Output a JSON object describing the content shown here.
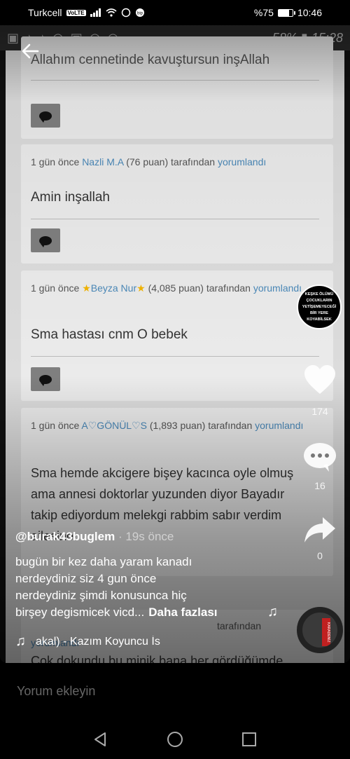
{
  "status_bar": {
    "carrier": "Turkcell",
    "volte": "VoLTE",
    "battery_text": "%75",
    "battery_level": 0.75,
    "time": "10:46"
  },
  "inner_status": {
    "battery_text": "58%",
    "time": "15:28"
  },
  "comments": [
    {
      "text_partial": "Allahım cennetinde kavuştursun inşAllah"
    },
    {
      "ago": "1 gün önce",
      "user": "Nazli M.A",
      "points": "(76 puan)",
      "by": "tarafından",
      "action": "yorumlandı",
      "text": "Amin inşallah"
    },
    {
      "ago": "1 gün önce",
      "user": "Beyza Nur",
      "points": "(4,085 puan)",
      "by": "tarafından",
      "action": "yorumlandı",
      "text": "Sma hastası cnm O bebek"
    },
    {
      "ago": "1 gün önce",
      "user": "A♡GÖNÜL♡S",
      "points": "(1,893 puan)",
      "by": "tarafından",
      "action": "yorumlandı",
      "text_lines": [
        "Sma hemde akcigere bişey kacınca oyle olmuş",
        "ama annesi doktorlar yuzunden diyor Bayadır",
        "takip ediyordum melekgi rabbim sabır verdim",
        "ailesine"
      ]
    },
    {
      "by": "tarafından",
      "action": "yorumlandı",
      "text_partial": "Çok dokundu bu minik bana her gördüğümde"
    }
  ],
  "video": {
    "username": "@burak43buglem",
    "ago": "· 19s önce",
    "caption_lines": [
      "bugün bir kez daha yaram kanadı",
      "nerdeydiniz siz 4 gun önce",
      "nerdeydiniz şimdi konusunca hiç",
      "birşey degismicek vicd..."
    ],
    "more_label": "Daha fazlası",
    "music": "akal) - Kazım Koyuncu    İs",
    "likes": "174",
    "comments_count": "16",
    "shares": "0",
    "avatar_text": "KEŞKE ÖLÜMÜ ÇOCUKLARIN YETİŞEMEYECEĞİ BİR YERE KOYABİLSEK",
    "disc_text": "KARADENİZ"
  },
  "comment_bar": {
    "placeholder": "Yorum ekleyin"
  }
}
